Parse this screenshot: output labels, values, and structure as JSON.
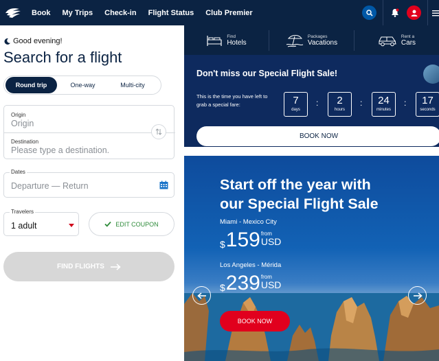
{
  "nav": {
    "links": [
      "Book",
      "My Trips",
      "Check-in",
      "Flight Status",
      "Club Premier"
    ],
    "icons": [
      "logo-icon",
      "search-icon",
      "bell-icon",
      "user-icon",
      "menu-icon"
    ]
  },
  "search": {
    "greeting": "Good evening!",
    "title": "Search for a flight",
    "trip_types": [
      "Round trip",
      "One-way",
      "Multi-city"
    ],
    "selected_trip": "Round trip",
    "origin_label": "Origin",
    "origin_placeholder": "Origin",
    "destination_label": "Destination",
    "destination_placeholder": "Please type a destination.",
    "dates_label": "Dates",
    "dates_placeholder": "Departure — Return",
    "travelers_label": "Travelers",
    "travelers_value": "1 adult",
    "coupon_label": "EDIT COUPON",
    "find_label": "FIND FLIGHTS"
  },
  "quick_links": [
    {
      "small": "Find",
      "big": "Hotels",
      "icon": "bed-icon"
    },
    {
      "small": "Packages",
      "big": "Vacations",
      "icon": "beach-icon"
    },
    {
      "small": "Rent a",
      "big": "Cars",
      "icon": "car-icon"
    }
  ],
  "sale": {
    "heading": "Don't miss our Special Flight Sale!",
    "desc": "This is the time you have left to grab a special fare:",
    "countdown": [
      {
        "value": "7",
        "unit": "days"
      },
      {
        "value": "2",
        "unit": "hours"
      },
      {
        "value": "24",
        "unit": "minutes"
      },
      {
        "value": "17",
        "unit": "seconds"
      }
    ],
    "book_label": "BOOK NOW"
  },
  "hero": {
    "title_line1": "Start off the year with",
    "title_line2": "our Special Flight Sale",
    "offers": [
      {
        "route": "Miami - Mexico City",
        "currency": "$",
        "amount": "159",
        "from": "from",
        "unit": "USD"
      },
      {
        "route": "Los Angeles - Mérida",
        "currency": "$",
        "amount": "239",
        "from": "from",
        "unit": "USD"
      }
    ],
    "book_label": "BOOK NOW"
  },
  "colors": {
    "navy": "#0b2343",
    "sale_bg": "#0e2a5e",
    "brand_red": "#e1001d",
    "coupon_green": "#2e8b3a"
  }
}
